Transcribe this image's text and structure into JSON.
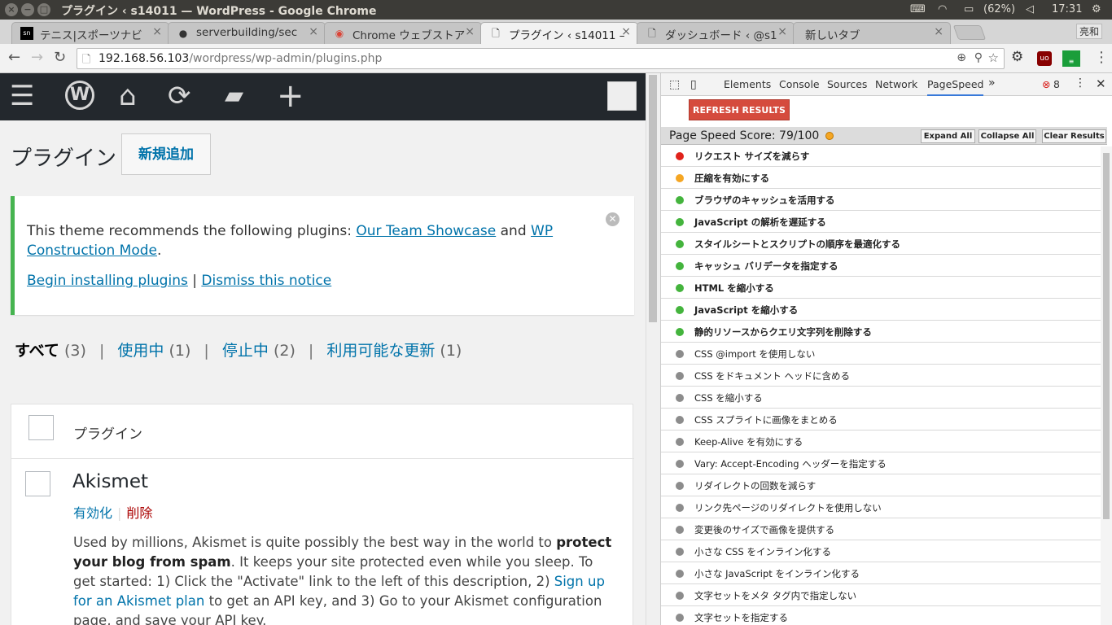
{
  "window": {
    "title": "プラグイン ‹ s14011 — WordPress - Google Chrome",
    "tray_battery": "(62%)",
    "tray_time": "17:31",
    "tray_user": "亮和"
  },
  "tabs": [
    {
      "label": "テニス|スポーツナビ",
      "favicon": "sportsnavi-icon"
    },
    {
      "label": "serverbuilding/sec",
      "favicon": "github-icon"
    },
    {
      "label": "Chrome ウェブストア",
      "favicon": "chrome-webstore-icon"
    },
    {
      "label": "プラグイン ‹ s14011 –",
      "favicon": "page-icon"
    },
    {
      "label": "ダッシュボード ‹ @s1",
      "favicon": "page-icon"
    },
    {
      "label": "新しいタブ",
      "favicon": ""
    }
  ],
  "address": {
    "host": "192.168.56.103",
    "path": "/wordpress/wp-admin/plugins.php"
  },
  "wp": {
    "page_title": "プラグイン",
    "add_new": "新規追加",
    "notice": {
      "text_before": "This theme recommends the following plugins: ",
      "link1": "Our Team Showcase",
      "and": " and ",
      "link2": "WP Construction Mode",
      "period": ".",
      "install_link": "Begin installing plugins",
      "sep": " | ",
      "dismiss_link": "Dismiss this notice"
    },
    "filters": [
      {
        "label": "すべて",
        "count": "(3)"
      },
      {
        "label": "使用中",
        "count": "(1)"
      },
      {
        "label": "停止中",
        "count": "(2)"
      },
      {
        "label": "利用可能な更新",
        "count": "(1)"
      }
    ],
    "filter_sep": "|",
    "table_header": "プラグイン",
    "plugin": {
      "name": "Akismet",
      "activate": "有効化",
      "delete": "削除",
      "desc_1": "Used by millions, Akismet is quite possibly the best way in the world to ",
      "desc_bold": "protect your blog from spam",
      "desc_2": ". It keeps your site protected even while you sleep. To get started: 1) Click the \"Activate\" link to the left of this description, 2) ",
      "desc_link": "Sign up for an Akismet plan",
      "desc_3": " to get an API key, and 3) Go to your Akismet configuration page, and save your API key."
    }
  },
  "devtools": {
    "tabs": [
      "Elements",
      "Console",
      "Sources",
      "Network",
      "PageSpeed"
    ],
    "more": "»",
    "error_count": "8",
    "refresh": "REFRESH RESULTS",
    "score_label": "Page Speed Score: 79/100",
    "expand_all": "Expand All",
    "collapse_all": "Collapse All",
    "clear_results": "Clear Results",
    "colors": {
      "red": "#e0221b",
      "orange": "#f5a623",
      "green": "#44b43d",
      "gray": "#8c8c8c"
    },
    "rules": [
      {
        "label": "リクエスト サイズを減らす",
        "status": "red",
        "bold": true
      },
      {
        "label": "圧縮を有効にする",
        "status": "orange",
        "bold": true
      },
      {
        "label": "ブラウザのキャッシュを活用する",
        "status": "green",
        "bold": true
      },
      {
        "label": "JavaScript の解析を遅延する",
        "status": "green",
        "bold": true
      },
      {
        "label": "スタイルシートとスクリプトの順序を最適化する",
        "status": "green",
        "bold": true
      },
      {
        "label": "キャッシュ バリデータを指定する",
        "status": "green",
        "bold": true
      },
      {
        "label": "HTML を縮小する",
        "status": "green",
        "bold": true
      },
      {
        "label": "JavaScript を縮小する",
        "status": "green",
        "bold": true
      },
      {
        "label": "静的リソースからクエリ文字列を削除する",
        "status": "green",
        "bold": true
      },
      {
        "label": "CSS @import を使用しない",
        "status": "gray",
        "bold": false
      },
      {
        "label": "CSS をドキュメント ヘッドに含める",
        "status": "gray",
        "bold": false
      },
      {
        "label": "CSS を縮小する",
        "status": "gray",
        "bold": false
      },
      {
        "label": "CSS スプライトに画像をまとめる",
        "status": "gray",
        "bold": false
      },
      {
        "label": "Keep-Alive を有効にする",
        "status": "gray",
        "bold": false
      },
      {
        "label": "Vary: Accept-Encoding ヘッダーを指定する",
        "status": "gray",
        "bold": false
      },
      {
        "label": "リダイレクトの回数を減らす",
        "status": "gray",
        "bold": false
      },
      {
        "label": "リンク先ページのリダイレクトを使用しない",
        "status": "gray",
        "bold": false
      },
      {
        "label": "変更後のサイズで画像を提供する",
        "status": "gray",
        "bold": false
      },
      {
        "label": "小さな CSS をインライン化する",
        "status": "gray",
        "bold": false
      },
      {
        "label": "小さな JavaScript をインライン化する",
        "status": "gray",
        "bold": false
      },
      {
        "label": "文字セットをメタ タグ内で指定しない",
        "status": "gray",
        "bold": false
      },
      {
        "label": "文字セットを指定する",
        "status": "gray",
        "bold": false
      }
    ]
  }
}
